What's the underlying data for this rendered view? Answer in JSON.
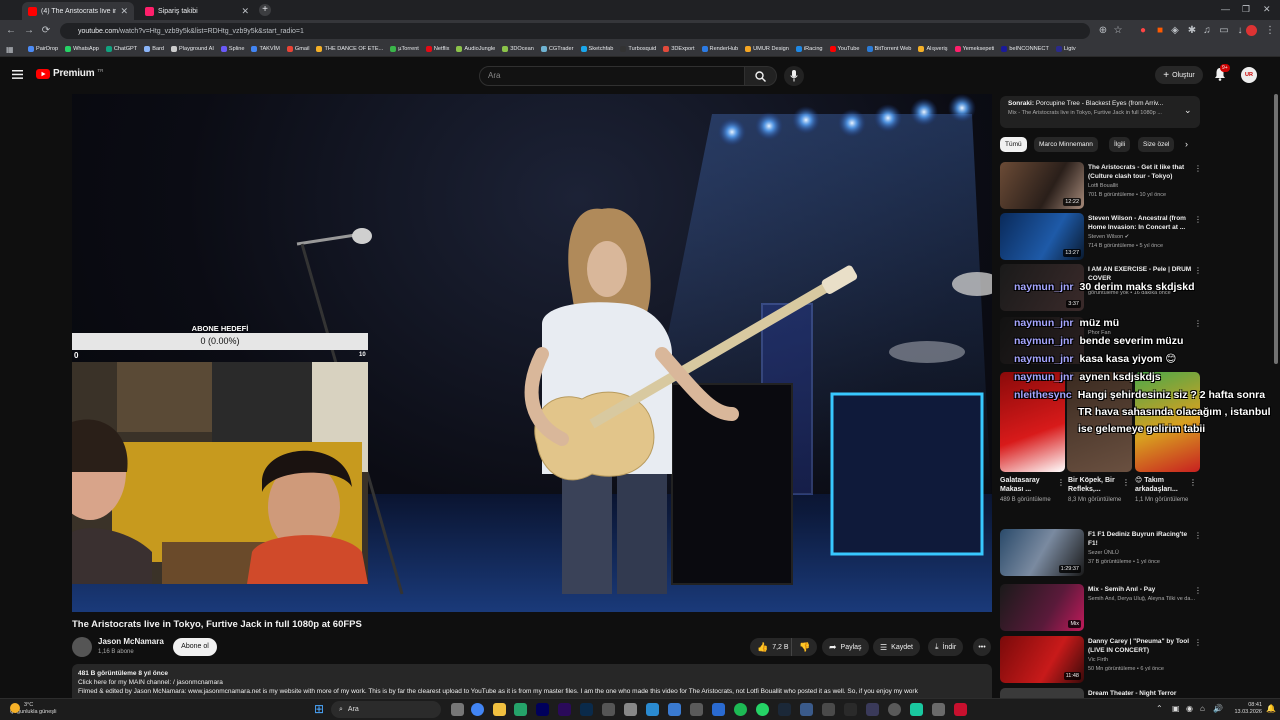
{
  "browser": {
    "tabs": [
      {
        "label": "(4) The Aristocrats live in T...",
        "color": "#ff0000",
        "active": true
      },
      {
        "label": "Sipariş takibi",
        "color": "#ff1f6b",
        "active": false
      }
    ],
    "url_host": "youtube.com",
    "url_path": "/watch?v=Htg_vzb9y5k&list=RDHtg_vzb9y5k&start_radio=1",
    "bookmarks": [
      "PairDrop",
      "WhatsApp",
      "ChatGPT",
      "Bard",
      "Playground AI",
      "Spline",
      "TAKVİM",
      "Gmail",
      "THE DANCE OF ETE...",
      "µTorrent",
      "Netflix",
      "AudioJungle",
      "3DOcean",
      "CGTrader",
      "Sketchfab",
      "Turbosquid",
      "3DExport",
      "RenderHub",
      "UMUR Design",
      "iRacing",
      "YouTube",
      "BitTorrent Web",
      "Alışveriş",
      "Yemeksepeti",
      "beINCONNECT",
      "Ligtv"
    ]
  },
  "header": {
    "logo": "Premium",
    "logo_sup": "TR",
    "search_placeholder": "Ara",
    "create_label": "Oluştur",
    "notif_count": "9+",
    "avatar_initials": "UR"
  },
  "overlay": {
    "goal_title": "ABONE HEDEFİ",
    "goal_value": "0 (0.00%)",
    "goal_min": "0",
    "goal_max": "10",
    "goal_progress": 0
  },
  "video": {
    "title": "The Aristocrats live in Tokyo, Furtive Jack in full 1080p at 60FPS",
    "channel": "Jason McNamara",
    "subs": "1,16 B abone",
    "subscribe_label": "Abone ol",
    "likes": "7,2 B",
    "share": "Paylaş",
    "save": "Kaydet",
    "download": "İndir",
    "desc_meta": "481 B görüntüleme  8 yıl önce",
    "desc_line1": "Click here for my MAIN channel:   / jasonmcnamara",
    "desc_line2": "Filmed & edited by Jason McNamara: www.jasonmcnamara.net is my website with more of my work. This is by far the clearest upload to YouTube as it is from my master files. I am the one who made this video for The Aristocrats, not Lotfi Bouallit who posted it as well. So, if you enjoy my work"
  },
  "sidebar": {
    "upnext_label": "Sonraki:",
    "upnext_title": "Porcupine Tree - Blackest Eyes (from Arriv...",
    "upnext_mix": "Mix - The Aristocrats live in Tokyo, Furtive Jack in full 1080p ...",
    "chips": [
      "Tümü",
      "Marco Minnemann",
      "İlgili",
      "Size özel"
    ],
    "recs": [
      {
        "title": "The Aristocrats - Get it like that (Culture clash tour - Tokyo)",
        "channel": "Lotfi Bouallit",
        "meta": "701 B görüntüleme • 10 yıl önce",
        "duration": "12:22"
      },
      {
        "title": "Steven Wilson - Ancestral (from Home Invasion: In Concert at ...",
        "channel": "Steven Wilson ✔",
        "meta": "714 B görüntüleme • 5 yıl önce",
        "duration": "13:27"
      },
      {
        "title": "I AM AN EXERCISE - Pele | DRUM COVER",
        "channel": "",
        "meta": "görüntüleme yok • 16 dakika önce",
        "duration": "3:37"
      },
      {
        "title": "",
        "channel": "Phor Fan",
        "meta": "",
        "duration": ""
      },
      {
        "title": "F1 F1 Dediniz Buyrun iRacing'te F1!",
        "channel": "Sezer ÜNLÜ",
        "meta": "37 B görüntüleme • 1 yıl önce",
        "duration": "1:29:37"
      },
      {
        "title": "Mix - Semih Anıl - Pay",
        "channel": "Semih Anıl, Derya Uluğ, Aleyna Tilki ve da...",
        "meta": "",
        "duration": "Mix"
      },
      {
        "title": "Danny Carey | \"Pneuma\" by Tool (LIVE IN CONCERT)",
        "channel": "Vic Firth",
        "meta": "50 Mn görüntüleme • 6 yıl önce",
        "duration": "11:48"
      },
      {
        "title": "Dream Theater - Night Terror",
        "channel": "",
        "meta": "",
        "duration": ""
      }
    ],
    "shorts": [
      {
        "title": "Galatasaray Makası ...",
        "views": "489 B görüntüleme"
      },
      {
        "title": "Bir Köpek, Bir Refleks,...",
        "views": "8,3 Mn görüntüleme"
      },
      {
        "title": "😊 Takım arkadaşları...",
        "views": "1,1 Mn görüntüleme"
      }
    ]
  },
  "chat": [
    {
      "user": "naymun_jnr",
      "msg": "30 derim maks skdjskd"
    },
    {
      "user": "naymun_jnr",
      "msg": "müz mü"
    },
    {
      "user": "naymun_jnr",
      "msg": "bende severim müzu"
    },
    {
      "user": "naymun_jnr",
      "msg": "kasa kasa yiyom 😊"
    },
    {
      "user": "naymun_jnr",
      "msg": "aynen ksdjskdjs"
    },
    {
      "user": "nleithesync",
      "msg": "Hangi şehirdesiniz siz ? 2 hafta sonra"
    },
    {
      "user": "",
      "msg": "TR hava sahasında olacağım , istanbul"
    },
    {
      "user": "",
      "msg": "ise gelemeye gelirim tabii"
    }
  ],
  "taskbar": {
    "weather_temp": "3°C",
    "weather_desc": "Çoğunlukla güneşli",
    "search": "Ara",
    "time": "08:41",
    "date": "13.03.2026"
  },
  "colors": {
    "yt_red": "#ff0000",
    "bg": "#0f0f0f",
    "chat_user": "#a6a6ff"
  }
}
